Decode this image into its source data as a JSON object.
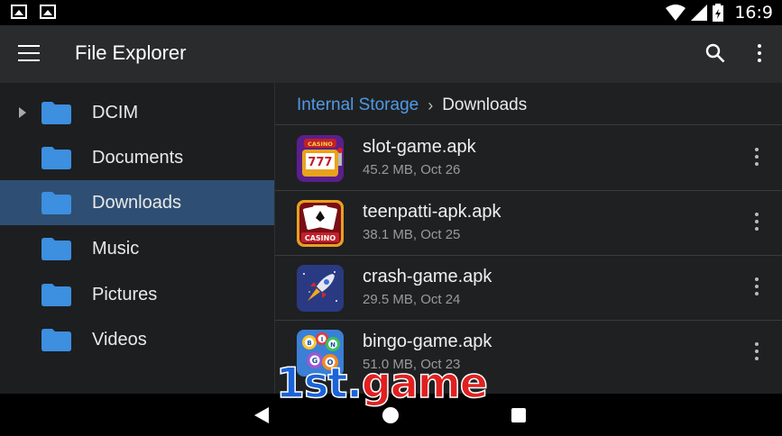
{
  "status_bar": {
    "time": "16:9"
  },
  "app_bar": {
    "title": "File Explorer"
  },
  "sidebar": {
    "items": [
      {
        "label": "DCIM",
        "expandable": true,
        "active": false
      },
      {
        "label": "Documents",
        "expandable": false,
        "active": false
      },
      {
        "label": "Downloads",
        "expandable": false,
        "active": true
      },
      {
        "label": "Music",
        "expandable": false,
        "active": false
      },
      {
        "label": "Pictures",
        "expandable": false,
        "active": false
      },
      {
        "label": "Videos",
        "expandable": false,
        "active": false
      }
    ]
  },
  "breadcrumb": {
    "root": "Internal Storage",
    "current": "Downloads"
  },
  "files": [
    {
      "name": "slot-game.apk",
      "meta": "45.2 MB, Oct 26",
      "icon": "slot-machine-icon",
      "badge": "CASINO",
      "reels": "777"
    },
    {
      "name": "teenpatti-apk.apk",
      "meta": "38.1 MB, Oct 25",
      "icon": "playing-cards-icon",
      "badge": "CASINO"
    },
    {
      "name": "crash-game.apk",
      "meta": "29.5 MB, Oct 24",
      "icon": "rocket-icon"
    },
    {
      "name": "bingo-game.apk",
      "meta": "51.0 MB, Oct 23",
      "icon": "bingo-balls-icon",
      "balls": [
        "B",
        "I",
        "N",
        "G",
        "O"
      ]
    }
  ],
  "watermark": {
    "part1": "1st.",
    "part2": "game"
  },
  "colors": {
    "accent": "#4f9ae6",
    "active_row": "#2e4f73",
    "folder": "#3d8fe0"
  }
}
